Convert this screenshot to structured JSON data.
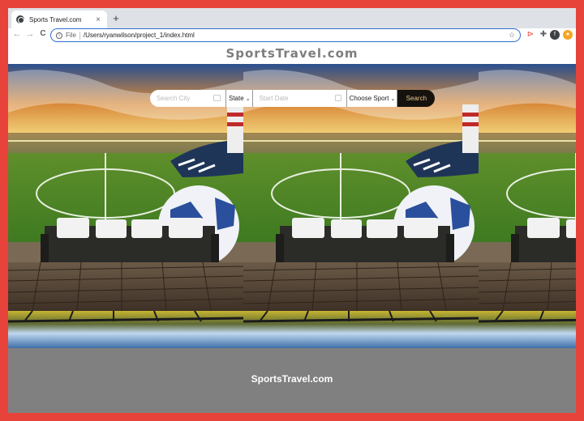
{
  "browser": {
    "tab_title": "Sports Travel.com",
    "tab_close": "×",
    "new_tab": "+",
    "back": "←",
    "forward": "→",
    "reload": "C",
    "url_scheme": "File",
    "url": "/Users/ryanwilson/project_1/index.html",
    "profile_initial": "f"
  },
  "site": {
    "logo": "SportsTravel.com",
    "footer": "SportsTravel.com"
  },
  "search": {
    "city_placeholder": "Search City",
    "state_label": "State",
    "date_placeholder": "Start Date",
    "sport_label": "Choose Sport",
    "button_label": "Search"
  },
  "colors": {
    "frame": "#e8433a",
    "footer_bg": "#808080",
    "search_button_bg": "#16120e",
    "search_button_text": "#e8c98c"
  }
}
